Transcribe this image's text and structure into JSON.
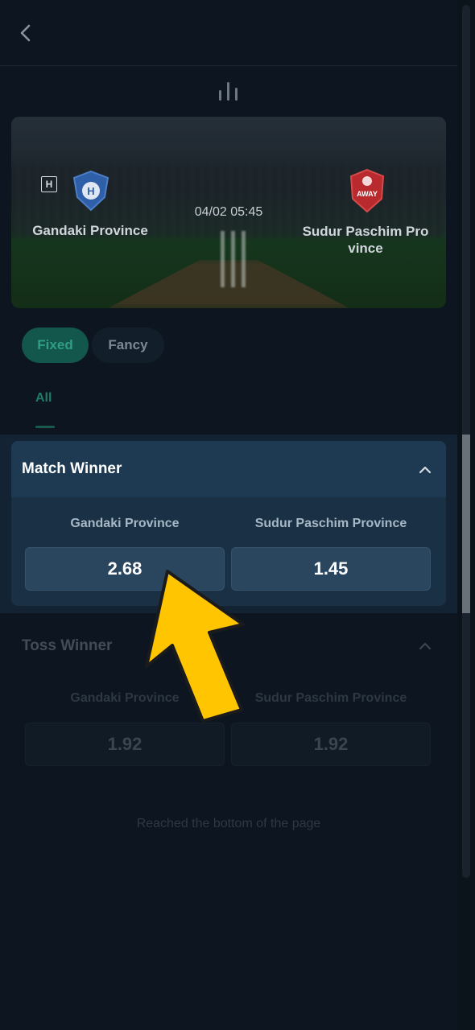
{
  "header": {
    "back_icon": "chevron-left-icon",
    "stats_icon": "bar-chart-icon"
  },
  "match": {
    "home_badge": "H",
    "home_team": "Gandaki Province",
    "away_team": "Sudur Paschim Province",
    "away_team_display": "Sudur Paschim Pro vince",
    "away_logo_text": "AWAY",
    "datetime": "04/02 05:45"
  },
  "tabs": [
    {
      "label": "Fixed",
      "active": true
    },
    {
      "label": "Fancy",
      "active": false
    }
  ],
  "subtabs": [
    {
      "label": "All",
      "active": true
    }
  ],
  "markets": [
    {
      "title": "Match Winner",
      "expanded": true,
      "runners": [
        {
          "name": "Gandaki Province",
          "odds": "2.68"
        },
        {
          "name": "Sudur Paschim Province",
          "odds": "1.45"
        }
      ]
    },
    {
      "title": "Toss Winner",
      "expanded": true,
      "runners": [
        {
          "name": "Gandaki Province",
          "odds": "1.92"
        },
        {
          "name": "Sudur Paschim Province",
          "odds": "1.92"
        }
      ]
    }
  ],
  "footer": {
    "end_text": "Reached the bottom of the page"
  },
  "colors": {
    "background": "#0d1620",
    "accent_green": "#2e9e85",
    "highlight_card": "#1e3a52",
    "pointer_arrow": "#ffc500"
  }
}
